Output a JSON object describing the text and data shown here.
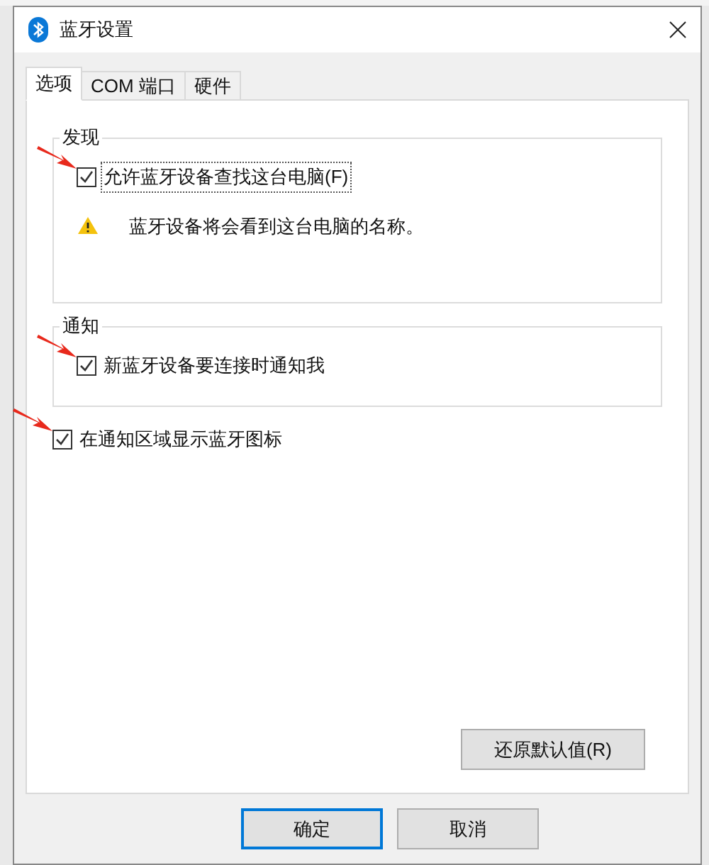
{
  "window": {
    "title": "蓝牙设置"
  },
  "tabs": [
    {
      "label": "选项",
      "selected": true
    },
    {
      "label": "COM 端口",
      "selected": false
    },
    {
      "label": "硬件",
      "selected": false
    }
  ],
  "groups": [
    {
      "title": "发现",
      "checkboxes": [
        {
          "label": "允许蓝牙设备查找这台电脑(F)",
          "checked": true,
          "focused": true,
          "highlighted": true
        }
      ],
      "warning": "蓝牙设备将会看到这台电脑的名称。"
    },
    {
      "title": "通知",
      "checkboxes": [
        {
          "label": "新蓝牙设备要连接时通知我",
          "checked": true,
          "focused": false,
          "highlighted": true
        }
      ]
    }
  ],
  "checkboxes": [
    {
      "label": "在通知区域显示蓝牙图标",
      "checked": true,
      "focused": false,
      "highlighted": true
    }
  ],
  "restore_button": "还原默认值(R)",
  "buttons": [
    {
      "label": "确定",
      "default": true
    },
    {
      "label": "取消",
      "default": false
    }
  ]
}
